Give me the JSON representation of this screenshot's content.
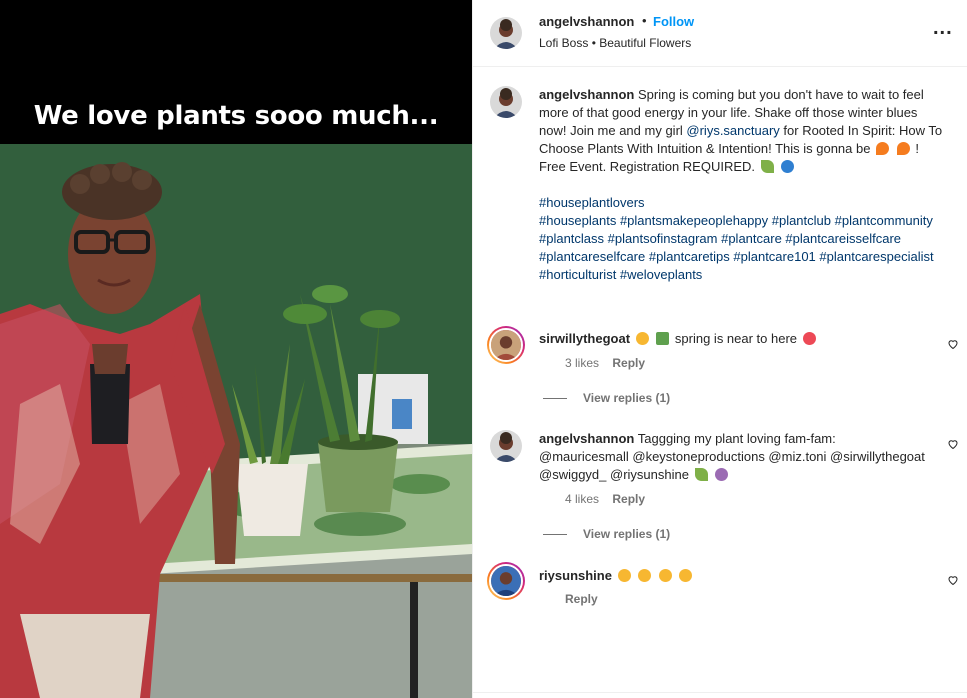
{
  "media": {
    "overlay_text": "We love plants sooo much..."
  },
  "header": {
    "username": "angelvshannon",
    "separator": "•",
    "follow_label": "Follow",
    "subtitle": "Lofi Boss • Beautiful Flowers",
    "more_label": "..."
  },
  "caption": {
    "username": "angelvshannon",
    "text_part1": "Spring is coming but you don't have to wait to feel more of that good energy in your life. Shake off those winter blues now! Join me and my girl ",
    "mention": "@riys.sanctuary",
    "text_part2": " for Rooted In Spirit: How To Choose Plants With Intuition & Intention! This is gonna be ",
    "text_part3": "! Free Event. Registration REQUIRED.",
    "hashtags": "#houseplantlovers",
    "hashtags2": "#houseplants #plantsmakepeoplehappy #plantclub #plantcommunity #plantclass #plantsofinstagram #plantcare #plantcareisselfcare #plantcareselfcare #plantcaretips #plantcare101 #plantcarespecialist #horticulturist #weloveplants"
  },
  "comments": [
    {
      "username": "sirwillythegoat",
      "text": "spring is near to here",
      "likes": "3 likes",
      "reply_label": "Reply",
      "view_replies": "View replies (1)"
    },
    {
      "username": "angelvshannon",
      "text_prefix": "Taggging my plant loving fam-fam:",
      "mentions": "@mauricesmall @keystoneproductions @miz.toni @sirwillythegoat @swiggyd_ @riysunshine",
      "likes": "4 likes",
      "reply_label": "Reply",
      "view_replies": "View replies (1)"
    },
    {
      "username": "riysunshine",
      "reply_label": "Reply"
    }
  ],
  "colors": {
    "link": "#00376b",
    "follow": "#0095f6",
    "muted": "#737373",
    "heart_red": "#ed4956"
  }
}
